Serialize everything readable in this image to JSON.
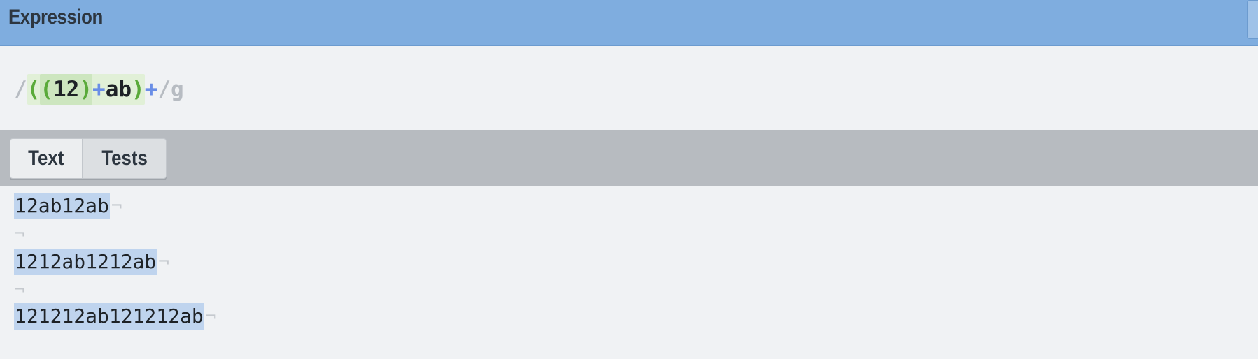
{
  "header": {
    "title": "Expression"
  },
  "expression": {
    "open_delim": "/",
    "outer_open": "(",
    "inner_open": "(",
    "inner_literal": "12",
    "inner_close": ")",
    "inner_quantifier": "+",
    "outer_literal": "ab",
    "outer_close": ")",
    "outer_quantifier": "+",
    "close_delim": "/",
    "flags": "g"
  },
  "tabs": [
    {
      "label": "Text"
    },
    {
      "label": "Tests"
    }
  ],
  "text": {
    "eol_glyph": "¬",
    "lines": [
      {
        "content": "12ab12ab"
      },
      {
        "content": ""
      },
      {
        "content": "1212ab1212ab"
      },
      {
        "content": ""
      },
      {
        "content": "121212ab121212ab"
      }
    ]
  },
  "colors": {
    "header_bg": "#7faddf",
    "tabs_bar_bg": "#b7bbc0",
    "match_highlight": "#bfd4ee",
    "group_paren": "#5aaa3a",
    "quantifier": "#6a8ee6",
    "delimiter": "#b7bcc2"
  }
}
